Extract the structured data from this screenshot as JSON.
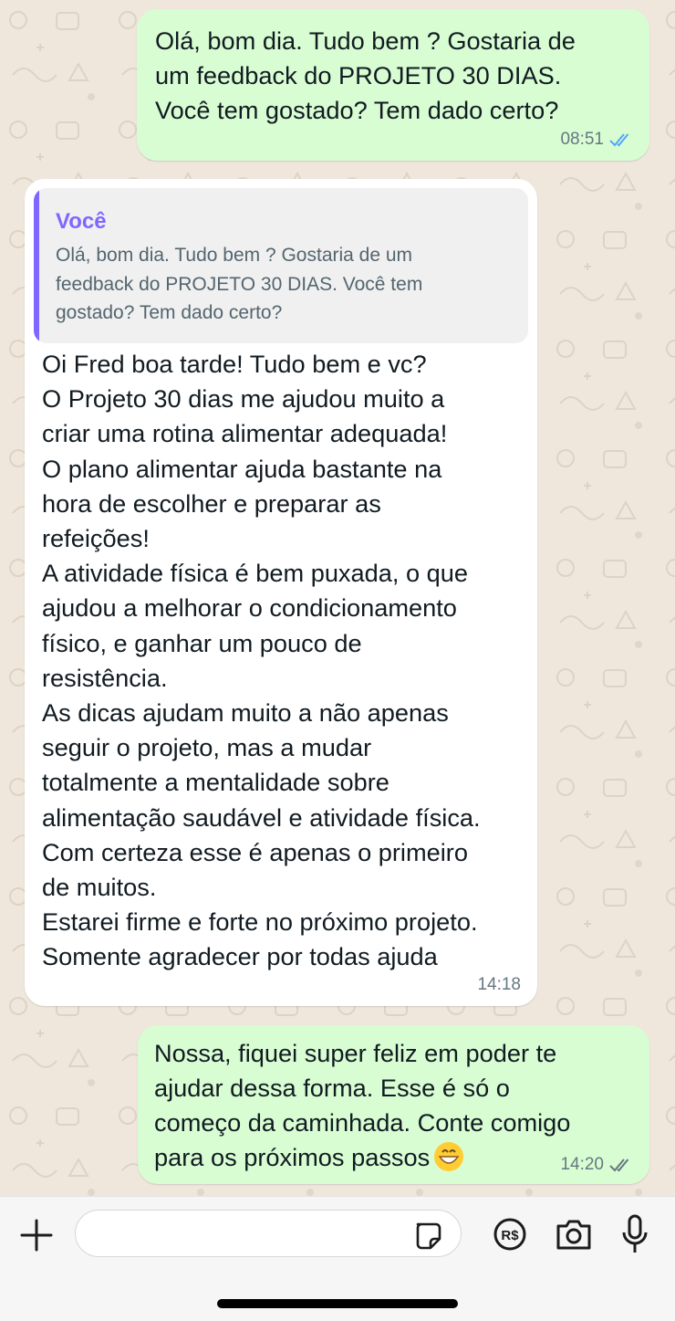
{
  "messages": [
    {
      "direction": "outgoing",
      "text": "Olá, bom dia. Tudo bem ? Gostaria de\num feedback do PROJETO 30 DIAS.\nVocê tem gostado? Tem dado certo?",
      "time": "08:51",
      "status": "read"
    },
    {
      "direction": "incoming",
      "quote": {
        "author": "Você",
        "text": "Olá, bom dia. Tudo bem ? Gostaria de um\nfeedback do PROJETO 30 DIAS. Você tem\ngostado? Tem dado certo?"
      },
      "text": "Oi Fred boa tarde! Tudo bem e vc?\nO Projeto 30 dias me ajudou muito a\ncriar uma rotina alimentar adequada!\nO plano alimentar ajuda bastante na\nhora de escolher e preparar as\nrefeições!\nA atividade física é bem puxada, o que\najudou a melhorar o condicionamento\nfísico, e ganhar um pouco de\nresistência.\nAs dicas ajudam muito a não apenas\nseguir o projeto, mas a mudar\ntotalmente a mentalidade sobre\nalimentação saudável e atividade física.\nCom certeza esse é apenas o primeiro\nde muitos.\nEstarei firme e forte no próximo projeto.\nSomente agradecer por todas ajuda",
      "time": "14:18"
    },
    {
      "direction": "outgoing",
      "text": "Nossa, fiquei super feliz em poder te\najudar dessa forma. Esse é só o\ncomeço da caminhada. Conte comigo\npara os próximos passos",
      "emoji": "grinning-face-icon",
      "time": "14:20",
      "status": "delivered"
    }
  ],
  "composer": {
    "input_value": "",
    "icons": [
      "plus-icon",
      "sticker-icon",
      "payment-icon",
      "camera-icon",
      "microphone-icon"
    ]
  },
  "colors": {
    "outgoing_bubble": "#d9fdd3",
    "incoming_bubble": "#ffffff",
    "quote_accent": "#7f66ff",
    "read_ticks": "#53a6fd",
    "delivered_ticks": "#667781",
    "wallpaper": "#efe7dc"
  }
}
